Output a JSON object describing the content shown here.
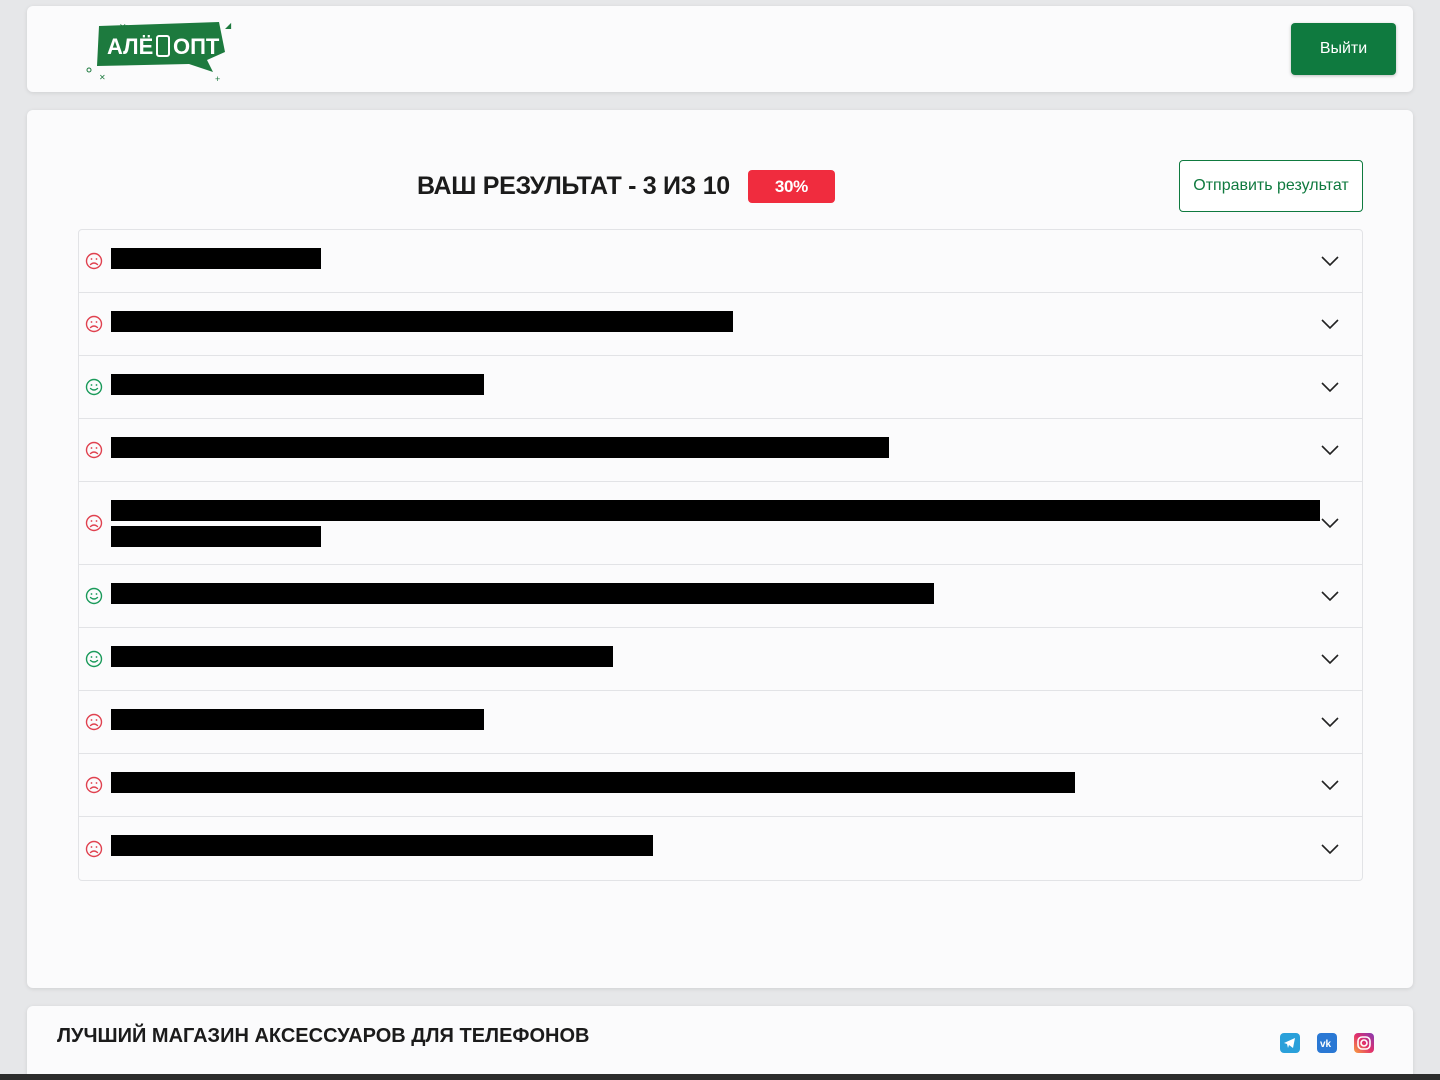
{
  "header": {
    "logo_text": "АЛЁ ОПТ",
    "logout_label": "Выйти"
  },
  "result": {
    "title": "ВАШ РЕЗУЛЬТАТ - 3 ИЗ 10",
    "score": 3,
    "total": 10,
    "percent_label": "30%",
    "send_label": "Отправить результат"
  },
  "questions": [
    {
      "status": "wrong",
      "redacted": true
    },
    {
      "status": "wrong",
      "redacted": true
    },
    {
      "status": "correct",
      "redacted": true
    },
    {
      "status": "wrong",
      "redacted": true
    },
    {
      "status": "wrong",
      "redacted": true
    },
    {
      "status": "correct",
      "redacted": true
    },
    {
      "status": "correct",
      "redacted": true
    },
    {
      "status": "wrong",
      "redacted": true
    },
    {
      "status": "wrong",
      "redacted": true
    },
    {
      "status": "wrong",
      "redacted": true
    }
  ],
  "footer": {
    "title": "ЛУЧШИЙ МАГАЗИН АКСЕССУАРОВ ДЛЯ ТЕЛЕФОНОВ",
    "social": [
      "telegram-icon",
      "vk-icon",
      "instagram-icon"
    ]
  },
  "colors": {
    "brand_green": "#0f7a3f",
    "badge_red": "#f02c3e",
    "wrong_icon": "#e0414f",
    "correct_icon": "#1a9a5a"
  }
}
